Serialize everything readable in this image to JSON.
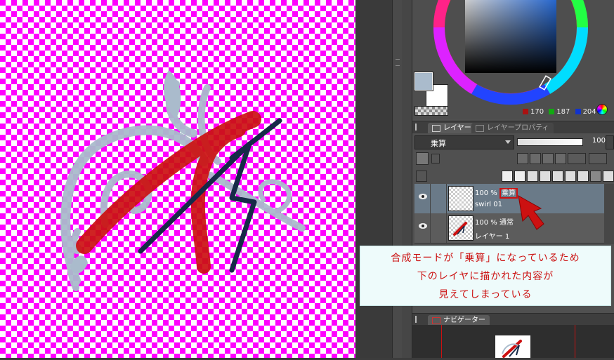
{
  "color": {
    "main_hex": "#aabbcc",
    "sub_hex": "#ffffff",
    "r": "170",
    "g": "187",
    "b": "204"
  },
  "tabs": {
    "layer": "レイヤー",
    "layer_property": "レイヤープロパティ",
    "navigator": "ナビゲーター"
  },
  "layer_panel": {
    "blend_mode": "乗算",
    "opacity": "100"
  },
  "layers": [
    {
      "opacity": "100 %",
      "mode": "乗算",
      "name": "swirl 01",
      "selected": true
    },
    {
      "opacity": "100 %",
      "mode": "通常",
      "name": "レイヤー 1",
      "selected": false
    }
  ],
  "callout": {
    "line1_pre": "合成モードが",
    "line1_key": "「乗算」",
    "line1_post": "になっているため",
    "line2": "下のレイヤに描かれた内容が",
    "line3": "見えてしまっている"
  },
  "accent": {
    "highlight": "#cc1111",
    "canvas_bg": "#ff00ff"
  }
}
